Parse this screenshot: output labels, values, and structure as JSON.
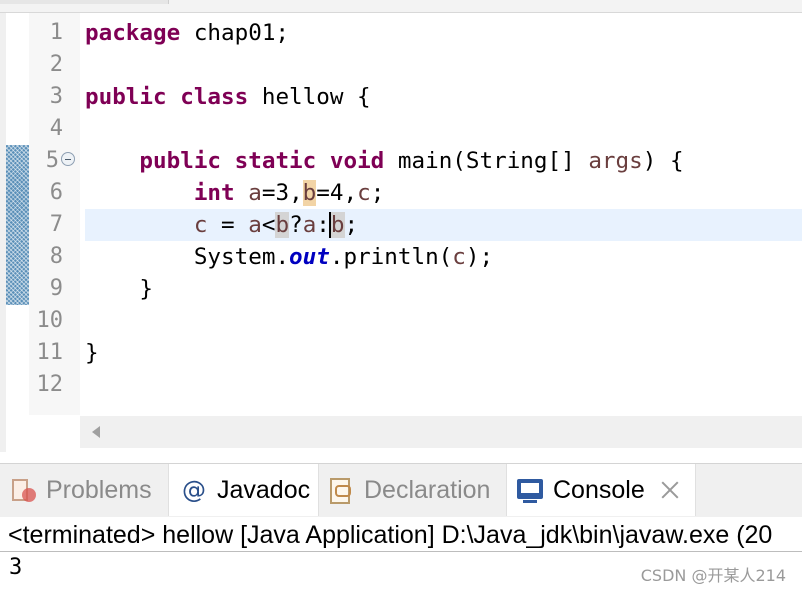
{
  "editor": {
    "line_numbers": [
      "1",
      "2",
      "3",
      "4",
      "5",
      "6",
      "7",
      "8",
      "9",
      "10",
      "11",
      "12"
    ],
    "code": {
      "l1": {
        "kw": "package",
        "rest": " chap01;"
      },
      "l3": {
        "kw": "public class",
        "rest": " hellow {"
      },
      "l5": {
        "indent": "    ",
        "kw": "public static void",
        "rest1": " main(String[] ",
        "param": "args",
        "rest2": ") {"
      },
      "l6": {
        "indent": "        ",
        "kw": "int",
        "sp": " ",
        "a": "a",
        "eq3": "=3,",
        "b": "b",
        "eq4": "=4,",
        "c": "c",
        "end": ";"
      },
      "l7": {
        "indent": "        ",
        "c": "c",
        "op1": " = ",
        "a1": "a",
        "lt": "<",
        "b1": "b",
        "q": "?",
        "a2": "a",
        "colon": ":",
        "b2": "b",
        "end": ";"
      },
      "l8": {
        "indent": "        ",
        "pre": "System.",
        "field": "out",
        "call": ".println(",
        "c": "c",
        "end": ");"
      },
      "l9": {
        "text": "    }"
      },
      "l11": {
        "text": "}"
      }
    }
  },
  "panel": {
    "tabs": {
      "problems": "Problems",
      "javadoc": "Javadoc",
      "javadoc_icon": "@",
      "declaration": "Declaration",
      "console": "Console"
    },
    "console_header": "<terminated> hellow [Java Application] D:\\Java_jdk\\bin\\javaw.exe (20",
    "console_output": "3"
  },
  "watermark": "CSDN @开某人214",
  "colors": {
    "keyword": "#7f0055",
    "variable": "#6a3e3e",
    "static_field": "#0000c0",
    "current_line": "#e8f2fe",
    "console_icon": "#2f5aa0"
  },
  "icons": [
    "problems-icon",
    "javadoc-icon",
    "declaration-icon",
    "console-icon",
    "close-icon",
    "fold-collapse-icon",
    "scroll-left-icon"
  ]
}
